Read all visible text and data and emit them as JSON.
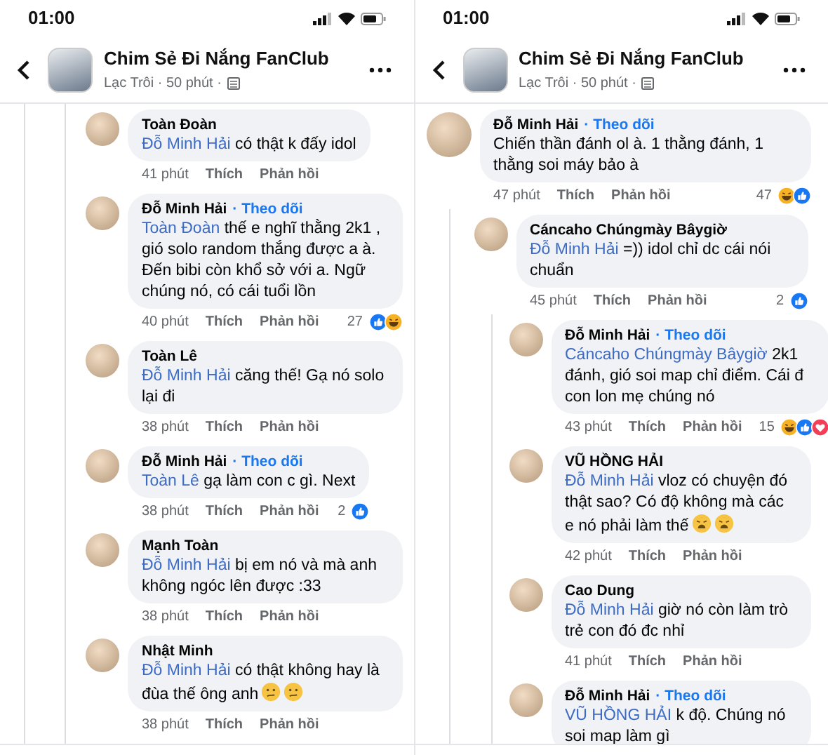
{
  "panels": [
    {
      "kind": "replies",
      "status_time": "01:00",
      "header": {
        "title": "Chim Sẻ Đi Nắng FanClub",
        "subtitle": "Lạc Trôi · 50 phút ·"
      },
      "comments": [
        {
          "author": "Toàn Đoàn",
          "mention": "Đỗ Minh Hải",
          "text": "có thật k đấy idol",
          "time": "41 phút",
          "like": "Thích",
          "reply": "Phản hồi"
        },
        {
          "author": "Đỗ Minh Hải",
          "follow": "· Theo dõi",
          "mention": "Toàn Đoàn",
          "text": "thế e nghĩ thằng 2k1 , gió solo random thắng được a à. Đến bibi còn khổ sở với a. Ngữ chúng nó, có cái tuổi lồn",
          "time": "40 phút",
          "like": "Thích",
          "reply": "Phản hồi",
          "reaction_count": "27",
          "reactions": [
            {
              "kind": "like"
            },
            {
              "kind": "haha"
            }
          ]
        },
        {
          "author": "Toàn Lê",
          "mention": "Đỗ Minh Hải",
          "text": "căng thế! Gạ nó solo lại đi",
          "time": "38 phút",
          "like": "Thích",
          "reply": "Phản hồi"
        },
        {
          "author": "Đỗ Minh Hải",
          "follow": "· Theo dõi",
          "mention": "Toàn Lê",
          "text": "gạ làm con c gì. Next",
          "time": "38 phút",
          "like": "Thích",
          "reply": "Phản hồi",
          "reaction_count": "2",
          "reactions": [
            {
              "kind": "like"
            }
          ]
        },
        {
          "author": "Mạnh Toàn",
          "mention": "Đỗ Minh Hải",
          "text": "bị em nó và mà anh không ngóc lên được :33",
          "time": "38 phút",
          "like": "Thích",
          "reply": "Phản hồi"
        },
        {
          "author": "Nhật Minh",
          "mention": "Đỗ Minh Hải",
          "text": "có thật không hay là đùa thế ông anh",
          "emojis": [
            {
              "kind": "confused"
            },
            {
              "kind": "confused"
            }
          ],
          "time": "38 phút",
          "like": "Thích",
          "reply": "Phản hồi"
        }
      ]
    },
    {
      "kind": "thread",
      "status_time": "01:00",
      "header": {
        "title": "Chim Sẻ Đi Nắng FanClub",
        "subtitle": "Lạc Trôi · 50 phút ·"
      },
      "comments": [
        {
          "author": "Đỗ Minh Hải",
          "follow": "· Theo dõi",
          "text": "Chiến thần đánh ol à. 1 thằng đánh, 1 thằng soi máy bảo à",
          "time": "47 phút",
          "like": "Thích",
          "reply": "Phản hồi",
          "reaction_count": "47",
          "reactions": [
            {
              "kind": "haha"
            },
            {
              "kind": "like"
            }
          ],
          "children": [
            {
              "author": "Cáncaho Chúngmày Bâygiờ",
              "mention": "Đỗ Minh Hải",
              "text": "=)) idol chỉ dc cái nói chuẩn",
              "time": "45 phút",
              "like": "Thích",
              "reply": "Phản hồi",
              "reaction_count": "2",
              "reactions": [
                {
                  "kind": "like"
                }
              ],
              "children": [
                {
                  "author": "Đỗ Minh Hải",
                  "follow": "· Theo dõi",
                  "mention": "Cáncaho Chúngmày Bâygiờ",
                  "text": "2k1 đánh, gió soi map chỉ điểm. Cái đ con lon mẹ chúng nó",
                  "time": "43 phút",
                  "like": "Thích",
                  "reply": "Phản hồi",
                  "reaction_count": "15",
                  "reactions": [
                    {
                      "kind": "haha"
                    },
                    {
                      "kind": "like"
                    },
                    {
                      "kind": "love"
                    }
                  ]
                },
                {
                  "author": "VŨ HỒNG HẢI",
                  "mention": "Đỗ Minh Hải",
                  "text": "vloz có chuyện đó thật sao? Có độ không mà các e nó phải làm thế",
                  "emojis": [
                    {
                      "kind": "weary"
                    },
                    {
                      "kind": "weary"
                    }
                  ],
                  "time": "42 phút",
                  "like": "Thích",
                  "reply": "Phản hồi"
                },
                {
                  "author": "Cao Dung",
                  "mention": "Đỗ Minh Hải",
                  "text": "giờ nó còn làm trò trẻ con đó đc nhỉ",
                  "time": "41 phút",
                  "like": "Thích",
                  "reply": "Phản hồi"
                },
                {
                  "author": "Đỗ Minh Hải",
                  "follow": "· Theo dõi",
                  "mention": "VŨ HỒNG HẢI",
                  "text": "k độ. Chúng nó soi map làm gì"
                }
              ]
            }
          ]
        }
      ]
    }
  ]
}
